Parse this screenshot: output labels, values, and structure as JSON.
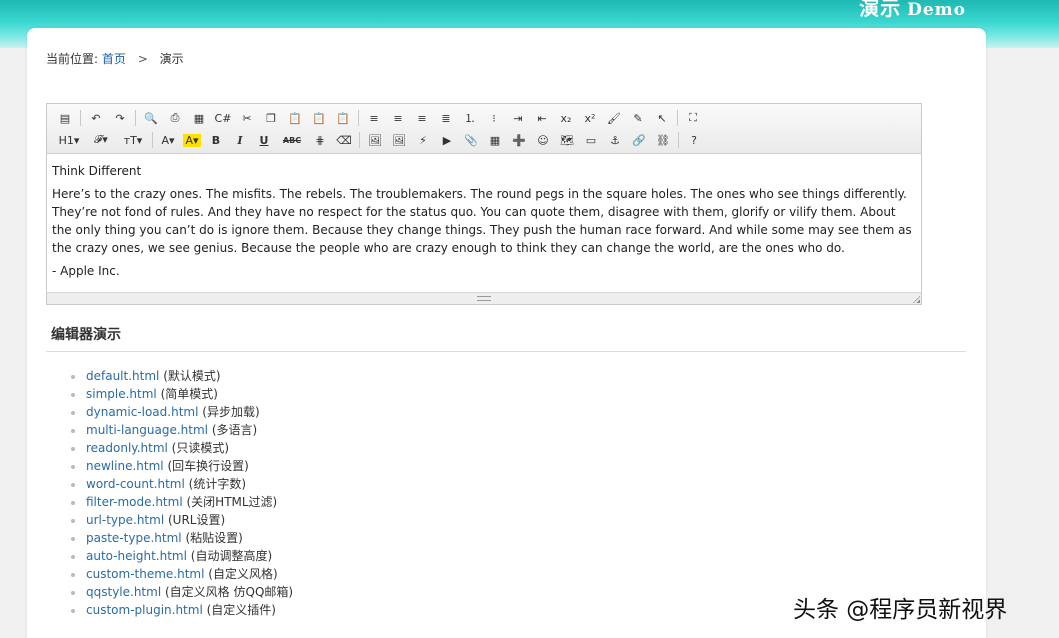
{
  "header": {
    "title": "演示",
    "subtitle": "Demo"
  },
  "breadcrumb": {
    "prefix": "当前位置:",
    "home": "首页",
    "separator": ">",
    "current": "演示"
  },
  "toolbar": {
    "row1": [
      {
        "name": "source-icon",
        "glyph": "▤"
      },
      {
        "sep": true
      },
      {
        "name": "undo-icon",
        "glyph": "↶"
      },
      {
        "name": "redo-icon",
        "glyph": "↷"
      },
      {
        "sep": true
      },
      {
        "name": "preview-icon",
        "glyph": "🔍"
      },
      {
        "name": "print-icon",
        "glyph": "⎙"
      },
      {
        "name": "template-icon",
        "glyph": "▦"
      },
      {
        "name": "code-icon",
        "glyph": "C#"
      },
      {
        "name": "cut-icon",
        "glyph": "✂"
      },
      {
        "name": "copy-icon",
        "glyph": "❐"
      },
      {
        "name": "paste-icon",
        "glyph": "📋"
      },
      {
        "name": "paste-plain-icon",
        "glyph": "📋"
      },
      {
        "name": "paste-word-icon",
        "glyph": "📋"
      },
      {
        "sep": true
      },
      {
        "name": "align-left-icon",
        "glyph": "≡"
      },
      {
        "name": "align-center-icon",
        "glyph": "≡"
      },
      {
        "name": "align-right-icon",
        "glyph": "≡"
      },
      {
        "name": "align-justify-icon",
        "glyph": "≣"
      },
      {
        "name": "ordered-list-icon",
        "glyph": "⒈"
      },
      {
        "name": "unordered-list-icon",
        "glyph": "⁝"
      },
      {
        "name": "indent-icon",
        "glyph": "⇥"
      },
      {
        "name": "outdent-icon",
        "glyph": "⇤"
      },
      {
        "name": "subscript-icon",
        "glyph": "x₂"
      },
      {
        "name": "superscript-icon",
        "glyph": "x²"
      },
      {
        "name": "clear-format-icon",
        "glyph": "🖌"
      },
      {
        "name": "quick-format-icon",
        "glyph": "✎"
      },
      {
        "name": "select-all-icon",
        "glyph": "↖"
      },
      {
        "sep": true
      },
      {
        "name": "fullscreen-icon",
        "glyph": "⛶"
      }
    ],
    "row2": [
      {
        "name": "heading-icon",
        "glyph": "H1▾"
      },
      {
        "name": "font-family-icon",
        "glyph": "𝓕▾"
      },
      {
        "name": "font-size-icon",
        "glyph": "тT▾"
      },
      {
        "sep": true
      },
      {
        "name": "font-color-icon",
        "glyph": "A▾"
      },
      {
        "name": "highlight-icon",
        "glyph": "A▾",
        "highlight": true
      },
      {
        "name": "bold-icon",
        "glyph": "B",
        "cls": "txt-b"
      },
      {
        "name": "italic-icon",
        "glyph": "I",
        "cls": "txt-i"
      },
      {
        "name": "underline-icon",
        "glyph": "U",
        "cls": "txt-u"
      },
      {
        "name": "strikethrough-icon",
        "glyph": "ABC",
        "cls": "txt-s"
      },
      {
        "name": "line-height-icon",
        "glyph": "⋕"
      },
      {
        "name": "eraser-icon",
        "glyph": "⌫"
      },
      {
        "sep": true
      },
      {
        "name": "image-icon",
        "glyph": "🖼"
      },
      {
        "name": "multi-image-icon",
        "glyph": "🖼"
      },
      {
        "name": "flash-icon",
        "glyph": "⚡"
      },
      {
        "name": "media-icon",
        "glyph": "▶"
      },
      {
        "name": "attachment-icon",
        "glyph": "📎"
      },
      {
        "name": "table-icon",
        "glyph": "▦"
      },
      {
        "name": "hr-icon",
        "glyph": "➕"
      },
      {
        "name": "emoticon-icon",
        "glyph": "☺"
      },
      {
        "name": "map-icon",
        "glyph": "🗺"
      },
      {
        "name": "page-break-icon",
        "glyph": "▭"
      },
      {
        "name": "anchor-icon",
        "glyph": "⚓"
      },
      {
        "name": "link-icon",
        "glyph": "🔗"
      },
      {
        "name": "unlink-icon",
        "glyph": "⛓"
      },
      {
        "sep": true
      },
      {
        "name": "help-icon",
        "glyph": "?"
      }
    ]
  },
  "editor": {
    "heading": "Think Different",
    "body": "Here’s to the crazy ones. The misfits. The rebels. The troublemakers. The round pegs in the square holes. The ones who see things differently. They’re not fond of rules. And they have no respect for the status quo. You can quote them, disagree with them, glorify or vilify them. About the only thing you can’t do is ignore them. Because they change things. They push the human race forward. And while some may see them as the crazy ones, we see genius. Because the people who are crazy enough to think they can change the world, are the ones who do.",
    "signature": "- Apple Inc."
  },
  "section": {
    "title": "编辑器演示"
  },
  "demos": [
    {
      "link": "default.html",
      "desc": "(默认模式)"
    },
    {
      "link": "simple.html",
      "desc": "(简单模式)"
    },
    {
      "link": "dynamic-load.html",
      "desc": "(异步加载)"
    },
    {
      "link": "multi-language.html",
      "desc": "(多语言)"
    },
    {
      "link": "readonly.html",
      "desc": "(只读模式)"
    },
    {
      "link": "newline.html",
      "desc": "(回车换行设置)"
    },
    {
      "link": "word-count.html",
      "desc": "(统计字数)"
    },
    {
      "link": "filter-mode.html",
      "desc": "(关闭HTML过滤)"
    },
    {
      "link": "url-type.html",
      "desc": "(URL设置)"
    },
    {
      "link": "paste-type.html",
      "desc": "(粘贴设置)"
    },
    {
      "link": "auto-height.html",
      "desc": "(自动调整高度)"
    },
    {
      "link": "custom-theme.html",
      "desc": "(自定义风格)"
    },
    {
      "link": "qqstyle.html",
      "desc": "(自定义风格 仿QQ邮箱)"
    },
    {
      "link": "custom-plugin.html",
      "desc": "(自定义插件)"
    }
  ],
  "watermark": "头条 @程序员新视界",
  "colors": {
    "accent": "#2a6ba5",
    "header_top": "#1fb8b2",
    "header_bottom": "#c8f2ef"
  }
}
